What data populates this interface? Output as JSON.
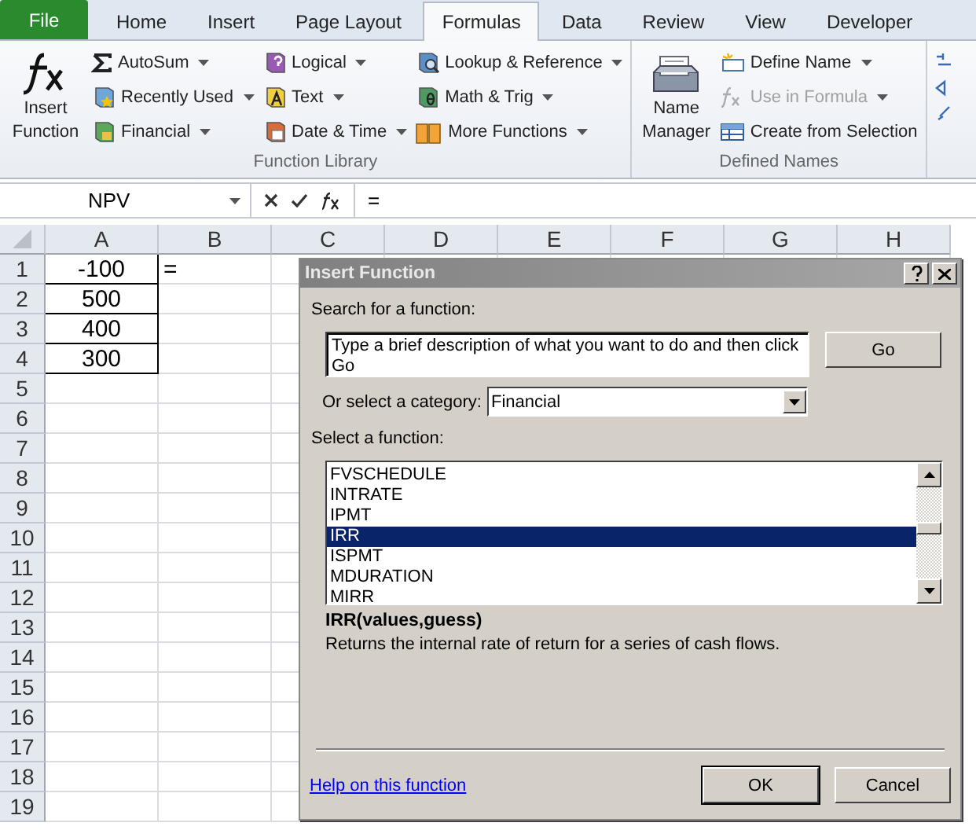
{
  "ribbon_tabs": [
    {
      "label": "File",
      "kind": "file",
      "selected": false
    },
    {
      "label": "Home",
      "kind": "tab",
      "selected": false
    },
    {
      "label": "Insert",
      "kind": "tab",
      "selected": false
    },
    {
      "label": "Page Layout",
      "kind": "tab",
      "selected": false
    },
    {
      "label": "Formulas",
      "kind": "tab",
      "selected": true
    },
    {
      "label": "Data",
      "kind": "tab",
      "selected": false
    },
    {
      "label": "Review",
      "kind": "tab",
      "selected": false
    },
    {
      "label": "View",
      "kind": "tab",
      "selected": false
    },
    {
      "label": "Developer",
      "kind": "tab",
      "selected": false
    }
  ],
  "function_library": {
    "label": "Function Library",
    "large_button": "Insert Function",
    "columns": [
      [
        {
          "label": "AutoSum",
          "disabled": false
        },
        {
          "label": "Recently Used",
          "disabled": false
        },
        {
          "label": "Financial",
          "disabled": false
        }
      ],
      [
        {
          "label": "Logical",
          "disabled": false
        },
        {
          "label": "Text",
          "disabled": false
        },
        {
          "label": "Date & Time",
          "disabled": false
        }
      ],
      [
        {
          "label": "Lookup & Reference",
          "disabled": false
        },
        {
          "label": "Math & Trig",
          "disabled": false
        },
        {
          "label": "More Functions",
          "disabled": false
        }
      ]
    ]
  },
  "defined_names": {
    "label": "Defined Names",
    "large_button": "Name Manager",
    "items": [
      {
        "label": "Define Name",
        "dropdown": true,
        "disabled": false
      },
      {
        "label": "Use in Formula",
        "dropdown": true,
        "disabled": true
      },
      {
        "label": "Create from Selection",
        "dropdown": false,
        "disabled": false
      }
    ]
  },
  "formula_bar": {
    "name_box": "NPV",
    "formula": "="
  },
  "sheet": {
    "columns": [
      "A",
      "B",
      "C",
      "D",
      "E",
      "F",
      "G",
      "H"
    ],
    "rows": [
      {
        "header": "1",
        "cells": [
          "-100",
          "="
        ]
      },
      {
        "header": "2",
        "cells": [
          "500"
        ]
      },
      {
        "header": "3",
        "cells": [
          "400"
        ]
      },
      {
        "header": "4",
        "cells": [
          "300"
        ]
      },
      {
        "header": "5",
        "cells": []
      },
      {
        "header": "6",
        "cells": []
      },
      {
        "header": "7",
        "cells": []
      },
      {
        "header": "8",
        "cells": []
      },
      {
        "header": "9",
        "cells": []
      },
      {
        "header": "10",
        "cells": []
      },
      {
        "header": "11",
        "cells": []
      },
      {
        "header": "12",
        "cells": []
      },
      {
        "header": "13",
        "cells": []
      },
      {
        "header": "14",
        "cells": []
      },
      {
        "header": "15",
        "cells": []
      },
      {
        "header": "16",
        "cells": []
      },
      {
        "header": "17",
        "cells": []
      },
      {
        "header": "18",
        "cells": []
      },
      {
        "header": "19",
        "cells": []
      }
    ]
  },
  "dialog": {
    "title": "Insert Function",
    "search_label": "Search for a function:",
    "search_value": "Type a brief description of what you want to do and then click Go",
    "go_button": "Go",
    "category_label": "Or select a category:",
    "category_value": "Financial",
    "function_label": "Select a function:",
    "functions": [
      {
        "label": "FVSCHEDULE",
        "selected": false
      },
      {
        "label": "INTRATE",
        "selected": false
      },
      {
        "label": "IPMT",
        "selected": false
      },
      {
        "label": "IRR",
        "selected": true
      },
      {
        "label": "ISPMT",
        "selected": false
      },
      {
        "label": "MDURATION",
        "selected": false
      },
      {
        "label": "MIRR",
        "selected": false
      }
    ],
    "signature": "IRR(values,guess)",
    "description": "Returns the internal rate of return for a series of cash flows.",
    "help_link": "Help on this function",
    "ok_button": "OK",
    "cancel_button": "Cancel"
  }
}
